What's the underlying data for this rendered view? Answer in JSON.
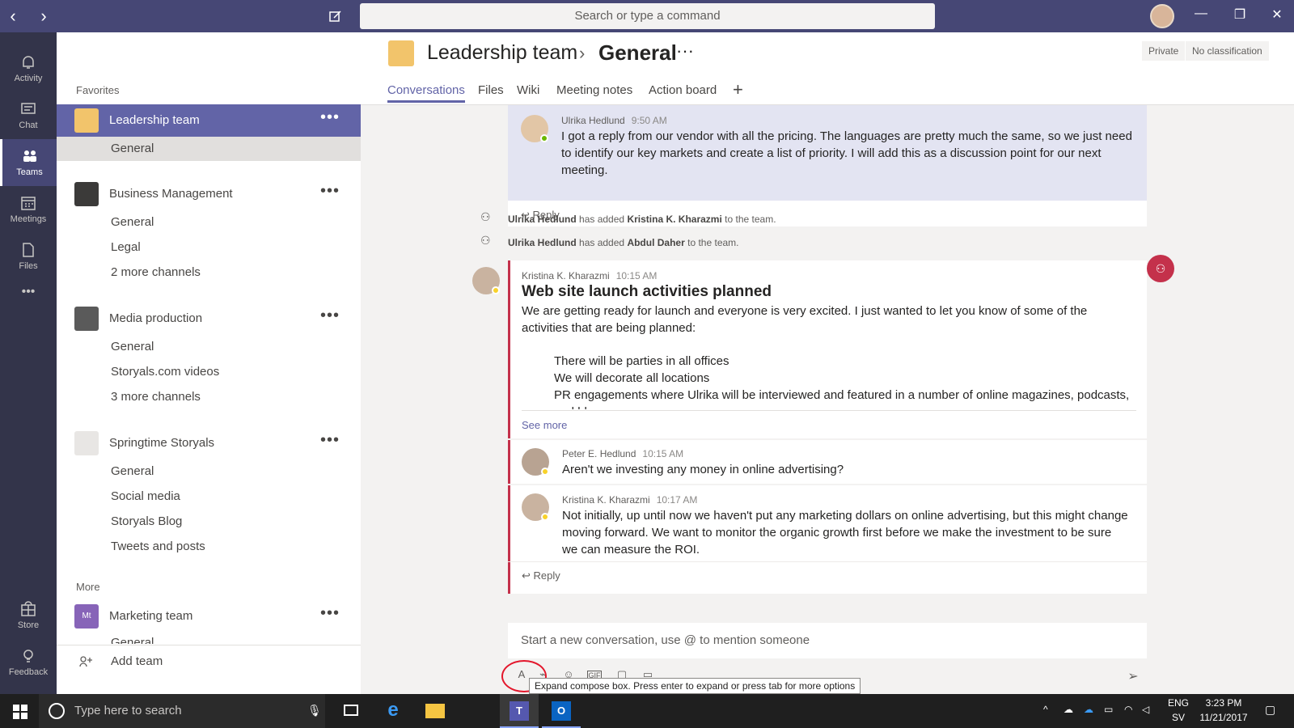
{
  "titlebar": {
    "search_placeholder": "Search or type a command",
    "back": "‹",
    "forward": "›",
    "minimize": "—",
    "restore": "❐",
    "close": "✕"
  },
  "rail": {
    "items": [
      {
        "label": "Activity",
        "icon": "bell-icon"
      },
      {
        "label": "Chat",
        "icon": "chat-icon"
      },
      {
        "label": "Teams",
        "icon": "teams-icon"
      },
      {
        "label": "Meetings",
        "icon": "calendar-icon"
      },
      {
        "label": "Files",
        "icon": "file-icon"
      },
      {
        "label": "Store",
        "icon": "store-icon"
      },
      {
        "label": "Feedback",
        "icon": "lightbulb-icon"
      }
    ],
    "more": "•••"
  },
  "teams_panel": {
    "favorites_label": "Favorites",
    "more_label": "More",
    "add_team": "Add team",
    "teams": [
      {
        "name": "Leadership team",
        "channels": [
          "General"
        ]
      },
      {
        "name": "Business Management",
        "channels": [
          "General",
          "Legal",
          "2 more channels"
        ]
      },
      {
        "name": "Media production",
        "channels": [
          "General",
          "Storyals.com videos",
          "3 more channels"
        ]
      },
      {
        "name": "Springtime Storyals",
        "channels": [
          "General",
          "Social media",
          "Storyals Blog",
          "Tweets and posts"
        ]
      },
      {
        "name": "Marketing team",
        "initials": "Mt",
        "channels": [
          "General"
        ]
      }
    ],
    "more_dots": "•••"
  },
  "header": {
    "team": "Leadership team",
    "separator": "›",
    "channel": "General",
    "more": "···",
    "badges": [
      "Private",
      "No classification"
    ],
    "tabs": [
      "Conversations",
      "Files",
      "Wiki",
      "Meeting notes",
      "Action board"
    ],
    "add_tab": "+"
  },
  "messages": {
    "first": {
      "author": "Ulrika Hedlund",
      "time": "9:50 AM",
      "body": "I got a reply from our vendor with all the pricing. The languages are pretty much the same, so we just need to identify our key markets and create a list of priority. I will add this as a discussion point for our next meeting."
    },
    "reply_label": "Reply",
    "system": [
      {
        "actor": "Ulrika Hedlund",
        "verb": "has added",
        "target": "Kristina K. Kharazmi",
        "suffix": "to the team."
      },
      {
        "actor": "Ulrika Hedlund",
        "verb": "has added",
        "target": "Abdul Daher",
        "suffix": "to the team."
      }
    ],
    "post": {
      "author": "Kristina K. Kharazmi",
      "time": "10:15 AM",
      "title": "Web site launch activities planned",
      "body": "We are getting ready for launch and everyone is very excited. I just wanted to let you know of some of the activities that are being planned:",
      "bullets": [
        "There will be parties in all offices",
        "We will decorate all locations",
        "PR engagements where Ulrika will be interviewed and featured in a number of online magazines, podcasts, and blogs"
      ],
      "see_more": "See more"
    },
    "replies": [
      {
        "author": "Peter E. Hedlund",
        "time": "10:15 AM",
        "body": "Aren't we investing any money in online advertising?"
      },
      {
        "author": "Kristina K. Kharazmi",
        "time": "10:17 AM",
        "body": "Not initially, up until now we haven't put any marketing dollars on online advertising, but this might change moving forward. We want to monitor the organic growth first before we make the investment to be sure we can measure the ROI."
      }
    ]
  },
  "compose": {
    "placeholder": "Start a new conversation, use @ to mention someone",
    "tooltip": "Expand compose box. Press enter to expand or press tab for more options",
    "icons": [
      "format-icon",
      "attach-icon",
      "emoji-icon",
      "gif-icon",
      "sticker-icon",
      "meet-now-icon"
    ]
  },
  "taskbar": {
    "search_placeholder": "Type here to search",
    "time": "3:23 PM",
    "date": "11/21/2017",
    "lang": "ENG",
    "region": "SV"
  },
  "colors": {
    "brand": "#6264a7",
    "titlebar": "#464775",
    "rail": "#33344a",
    "announcement": "#c4314b"
  }
}
